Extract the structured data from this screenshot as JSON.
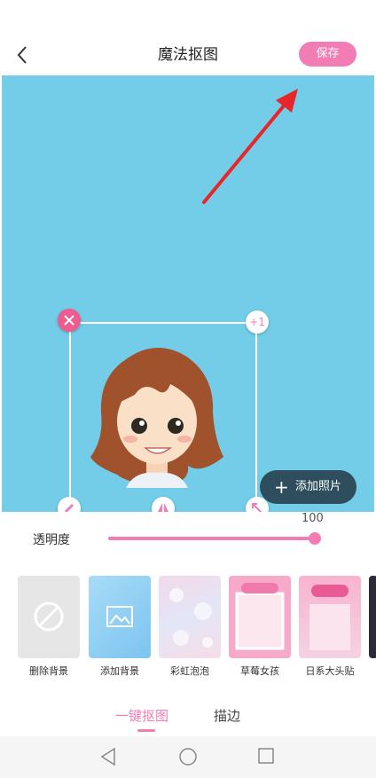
{
  "header": {
    "title": "魔法抠图",
    "save_label": "保存"
  },
  "canvas": {
    "background_color": "#73cde9",
    "add_photo_label": "添加照片",
    "plus_one_label": "+1"
  },
  "opacity": {
    "label": "透明度",
    "value": "100"
  },
  "backgrounds": [
    {
      "label": "删除背景",
      "icon": "prohibited-icon"
    },
    {
      "label": "添加背景",
      "icon": "image-icon"
    },
    {
      "label": "彩虹泡泡",
      "icon": "bubble-thumbnail"
    },
    {
      "label": "草莓女孩",
      "icon": "strawberry-thumbnail"
    },
    {
      "label": "日系大头贴",
      "icon": "love-thumbnail"
    }
  ],
  "tabs": [
    {
      "label": "一键抠图",
      "active": true
    },
    {
      "label": "描边",
      "active": false
    }
  ],
  "accent_color": "#f27db4"
}
